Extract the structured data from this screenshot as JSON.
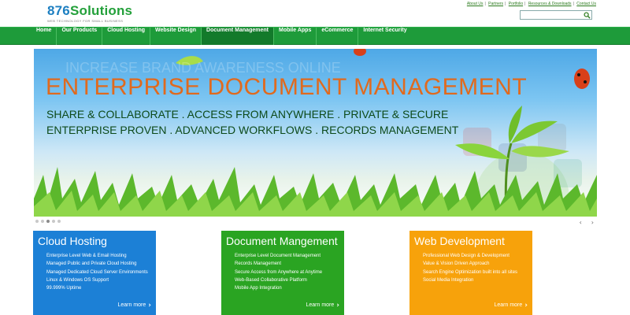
{
  "logo": {
    "number": "876",
    "word": "Solutions",
    "tagline": "WEB TECHNOLOGY FOR SMALL BUSINESS"
  },
  "top_links": [
    "About Us",
    "Partners",
    "Portfolio",
    "Resources & Downloads",
    "Contact Us"
  ],
  "search": {
    "value": "",
    "placeholder": "",
    "icon": "search-icon"
  },
  "nav": [
    "Home",
    "Our Products",
    "Cloud Hosting",
    "Website Design",
    "Document Management",
    "Mobile Apps",
    "eCommerce",
    "Internet Security"
  ],
  "nav_active": "Document Management",
  "hero": {
    "background_text": "INCREASE BRAND AWARENESS ONLINE",
    "title": "ENTERPRISE DOCUMENT MANAGEMENT",
    "line1": "SHARE & COLLABORATE . ACCESS FROM ANYWHERE . PRIVATE & SECURE",
    "line2": "ENTERPRISE PROVEN . ADVANCED WORKFLOWS . RECORDS MANAGEMENT"
  },
  "slider": {
    "count": 5,
    "active": 3,
    "prev": "‹",
    "next": "›"
  },
  "panels": [
    {
      "title": "Cloud Hosting",
      "color": "#1c80d6",
      "items": [
        "Enterprise Level Web & Email Hosting",
        "Managed Public and Private Cloud Hosting",
        "Managed Dedicated Cloud Server Environments",
        "Linux & Windows OS Support",
        "99.999% Uptime"
      ],
      "learn_more": "Learn more"
    },
    {
      "title": "Document Mangement",
      "color": "#2aa422",
      "items": [
        "Enterprise Level Document Management",
        "Records Management",
        "Secure Access from Anywhere at Anytime",
        "Web-Based Collaborative Platform",
        "Mobile App Integration"
      ],
      "learn_more": "Learn more"
    },
    {
      "title": "Web Development",
      "color": "#f7a20b",
      "items": [
        "Professional Web Design & Development",
        "Value & Vision Driven Approach",
        "Search Engine Optimization built into all sites",
        "Social Media Integration"
      ],
      "learn_more": "Learn more"
    }
  ],
  "colors": {
    "nav_green": "#1e9b3a",
    "hero_orange": "#e06a1e",
    "hero_dark_green": "#0d4a1a"
  }
}
